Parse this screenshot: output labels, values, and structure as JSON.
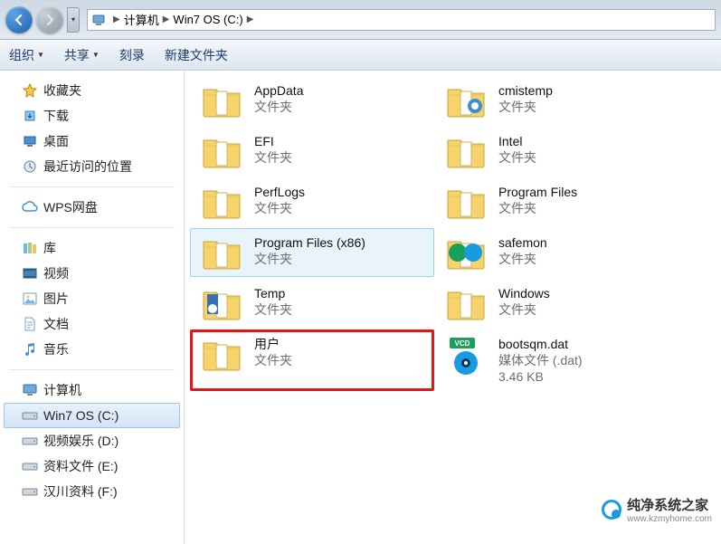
{
  "nav": {
    "breadcrumb": [
      "计算机",
      "Win7 OS (C:)"
    ]
  },
  "toolbar": {
    "organize": "组织",
    "share": "共享",
    "burn": "刻录",
    "newfolder": "新建文件夹"
  },
  "sidebar": {
    "favorites": {
      "label": "收藏夹",
      "items": [
        {
          "label": "下载",
          "icon": "download"
        },
        {
          "label": "桌面",
          "icon": "desktop"
        },
        {
          "label": "最近访问的位置",
          "icon": "recent"
        }
      ]
    },
    "wps": {
      "label": "WPS网盘"
    },
    "libraries": {
      "label": "库",
      "items": [
        {
          "label": "视频",
          "icon": "video"
        },
        {
          "label": "图片",
          "icon": "picture"
        },
        {
          "label": "文档",
          "icon": "doc"
        },
        {
          "label": "音乐",
          "icon": "music"
        }
      ]
    },
    "computer": {
      "label": "计算机",
      "items": [
        {
          "label": "Win7 OS (C:)",
          "icon": "drive",
          "selected": true
        },
        {
          "label": "视频娱乐 (D:)",
          "icon": "drive"
        },
        {
          "label": "资料文件 (E:)",
          "icon": "drive"
        },
        {
          "label": "汉川资料 (F:)",
          "icon": "drive"
        }
      ]
    }
  },
  "items": {
    "type_folder": "文件夹",
    "left": [
      {
        "name": "AppData",
        "type": "文件夹",
        "icon": "folder"
      },
      {
        "name": "EFI",
        "type": "文件夹",
        "icon": "folder"
      },
      {
        "name": "PerfLogs",
        "type": "文件夹",
        "icon": "folder"
      },
      {
        "name": "Program Files (x86)",
        "type": "文件夹",
        "icon": "folder",
        "selected": true
      },
      {
        "name": "Temp",
        "type": "文件夹",
        "icon": "folder-sys"
      },
      {
        "name": "用户",
        "type": "文件夹",
        "icon": "folder",
        "highlight": true
      }
    ],
    "right": [
      {
        "name": "cmistemp",
        "type": "文件夹",
        "icon": "folder-ie"
      },
      {
        "name": "Intel",
        "type": "文件夹",
        "icon": "folder"
      },
      {
        "name": "Program Files",
        "type": "文件夹",
        "icon": "folder"
      },
      {
        "name": "safemon",
        "type": "文件夹",
        "icon": "folder-360"
      },
      {
        "name": "Windows",
        "type": "文件夹",
        "icon": "folder"
      },
      {
        "name": "bootsqm.dat",
        "type": "媒体文件 (.dat)",
        "size": "3.46 KB",
        "icon": "vcd"
      }
    ]
  },
  "watermark": {
    "title": "纯净系统之家",
    "url": "www.kzmyhome.com"
  }
}
